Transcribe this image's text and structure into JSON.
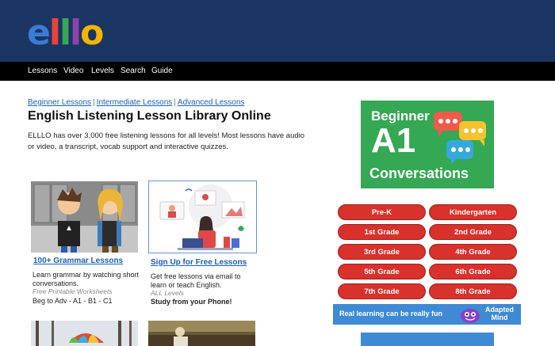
{
  "logo": {
    "letters": [
      "e",
      "l",
      "l",
      "l",
      "o"
    ],
    "colors": [
      "#3a7bd5",
      "#e8433a",
      "#34a853",
      "#8e44ad",
      "#f4b400"
    ]
  },
  "nav": {
    "items": [
      "Lessons",
      "Video",
      "Levels",
      "Search",
      "Guide"
    ]
  },
  "crumbs": {
    "beginner": "Beginner Lessons",
    "intermediate": "Intermediate Lessons",
    "advanced": "Advanced Lessons",
    "sep": "|"
  },
  "main": {
    "title": "English Listening Lesson Library Online",
    "intro": "ELLLO has over 3,000 free listening lessons for all levels! Most lessons have audio or video, a transcript, vocab support and interactive quizzes."
  },
  "cards": [
    {
      "title": "100+ Grammar Lessons",
      "text": "Learn grammar by watching short conversations.",
      "note": "Free Printable Worksheets",
      "extra": "Beg to Adv - A1 - B1 - C1"
    },
    {
      "title": "Sign Up for Free Lessons",
      "text": "Get free lessons via email to learn or teach English.",
      "note": "ALL Levels",
      "extra": "Study from your Phone!"
    }
  ],
  "ads": {
    "a1": {
      "line1": "Beginner",
      "line2": "A1",
      "line3": "Conversations"
    },
    "grades": [
      "Pre-K",
      "Kindergarten",
      "1st Grade",
      "2nd Grade",
      "3rd Grade",
      "4th Grade",
      "5th Grade",
      "6th Grade",
      "7th Grade",
      "8th Grade"
    ],
    "adapted": {
      "text": "Real learning can be really fun",
      "brand_line1": "Adapted",
      "brand_line2": "Mind"
    },
    "close": "×"
  },
  "colors": {
    "header": "#1b3562",
    "nav": "#000000",
    "link": "#1a5fb4",
    "ad_green": "#34a853",
    "grade_red": "#d9312b",
    "adapted_blue": "#3e8ad4"
  }
}
